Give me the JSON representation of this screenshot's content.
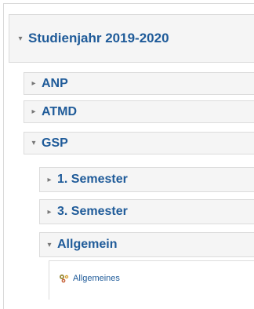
{
  "tree": {
    "root": {
      "label": "Studienjahr 2019-2020",
      "expanded": true
    },
    "children": [
      {
        "label": "ANP",
        "expanded": false
      },
      {
        "label": "ATMD",
        "expanded": false
      },
      {
        "label": "GSP",
        "expanded": true
      }
    ],
    "gsp_children": [
      {
        "label": "1. Semester",
        "expanded": false
      },
      {
        "label": "3. Semester",
        "expanded": false
      },
      {
        "label": "Allgemein",
        "expanded": true
      }
    ],
    "allgemein_children": [
      {
        "label": "Allgemeines",
        "icon": "gear-cluster-icon"
      }
    ],
    "icons": {
      "expanded": "▾",
      "collapsed": "▸"
    }
  },
  "colors": {
    "link": "#1f5b99",
    "node_bg": "#f5f5f5",
    "border": "#dcdcdc"
  }
}
